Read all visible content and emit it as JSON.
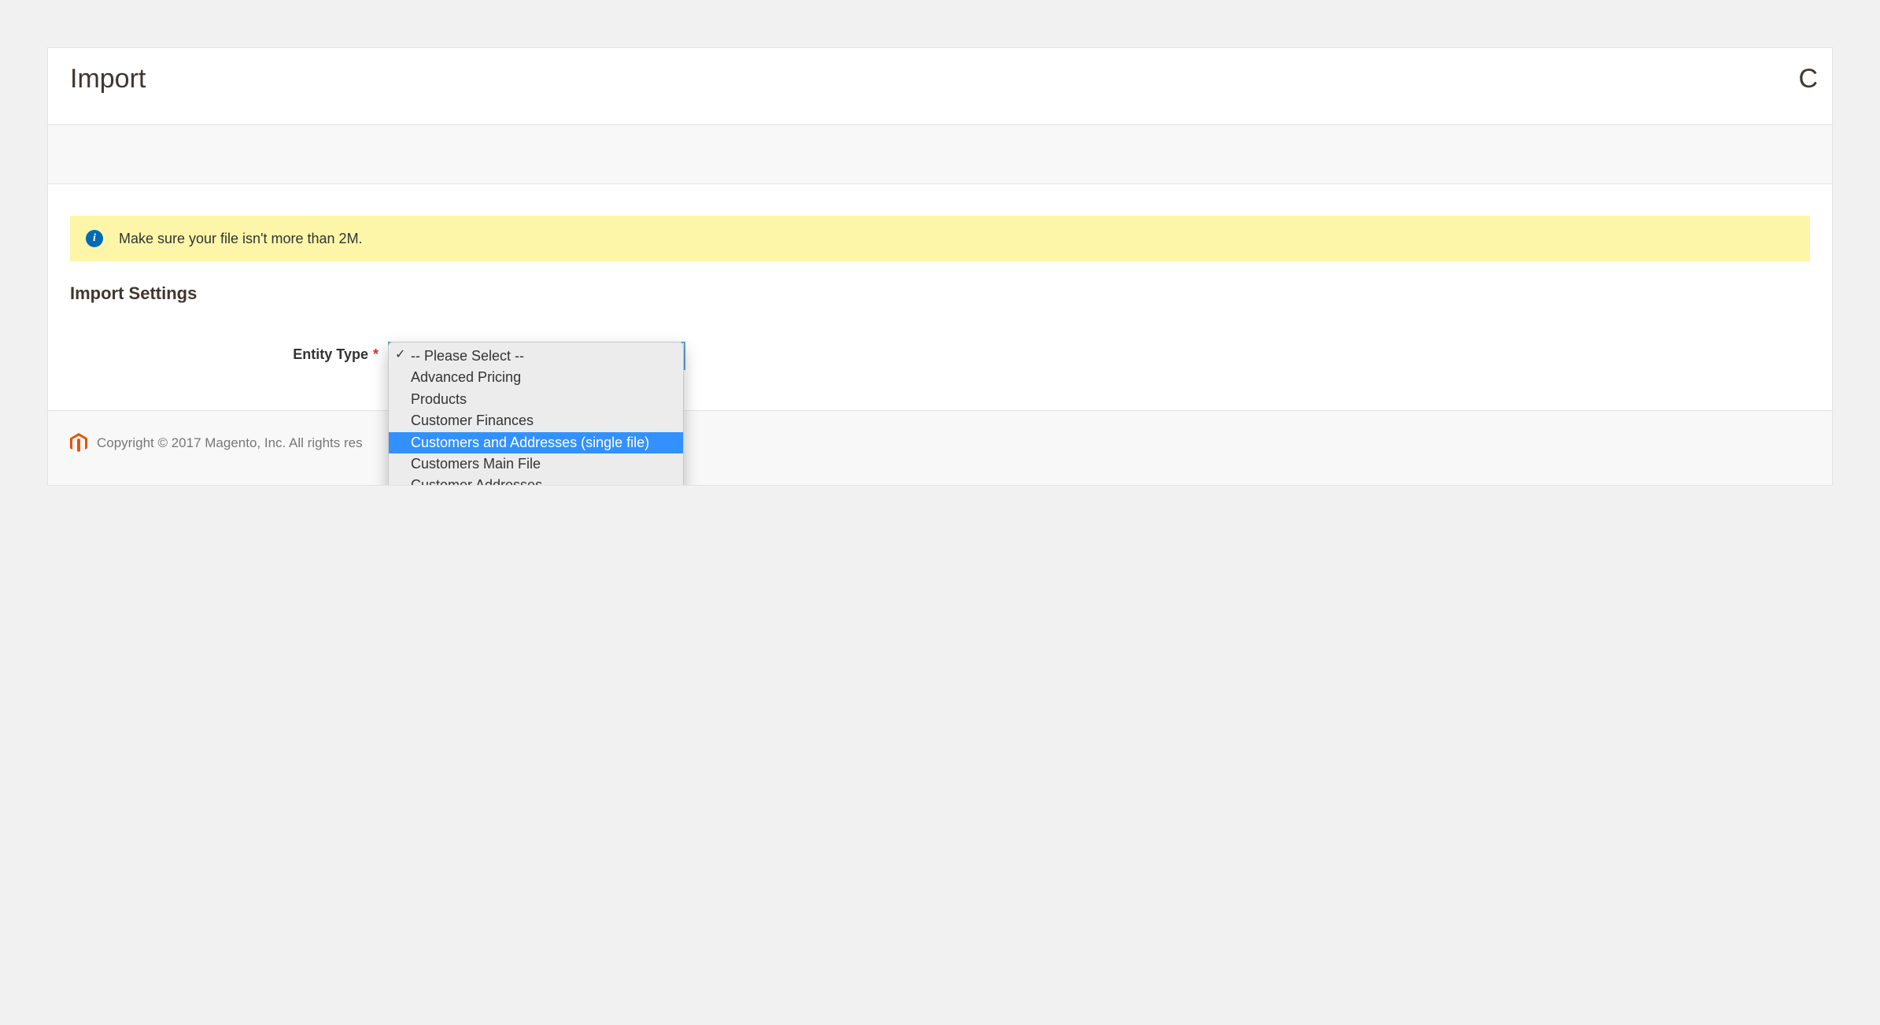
{
  "header": {
    "title": "Import",
    "clipped_char": "C"
  },
  "notice": {
    "text": "Make sure your file isn't more than 2M."
  },
  "section": {
    "heading": "Import Settings"
  },
  "form": {
    "entity_type": {
      "label": "Entity Type",
      "required_marker": "*",
      "options": [
        "-- Please Select --",
        "Advanced Pricing",
        "Products",
        "Customer Finances",
        "Customers and Addresses (single file)",
        "Customers Main File",
        "Customer Addresses"
      ],
      "selected_index": 0,
      "highlighted_index": 4
    }
  },
  "footer": {
    "copyright": "Copyright © 2017 Magento, Inc. All rights res"
  }
}
